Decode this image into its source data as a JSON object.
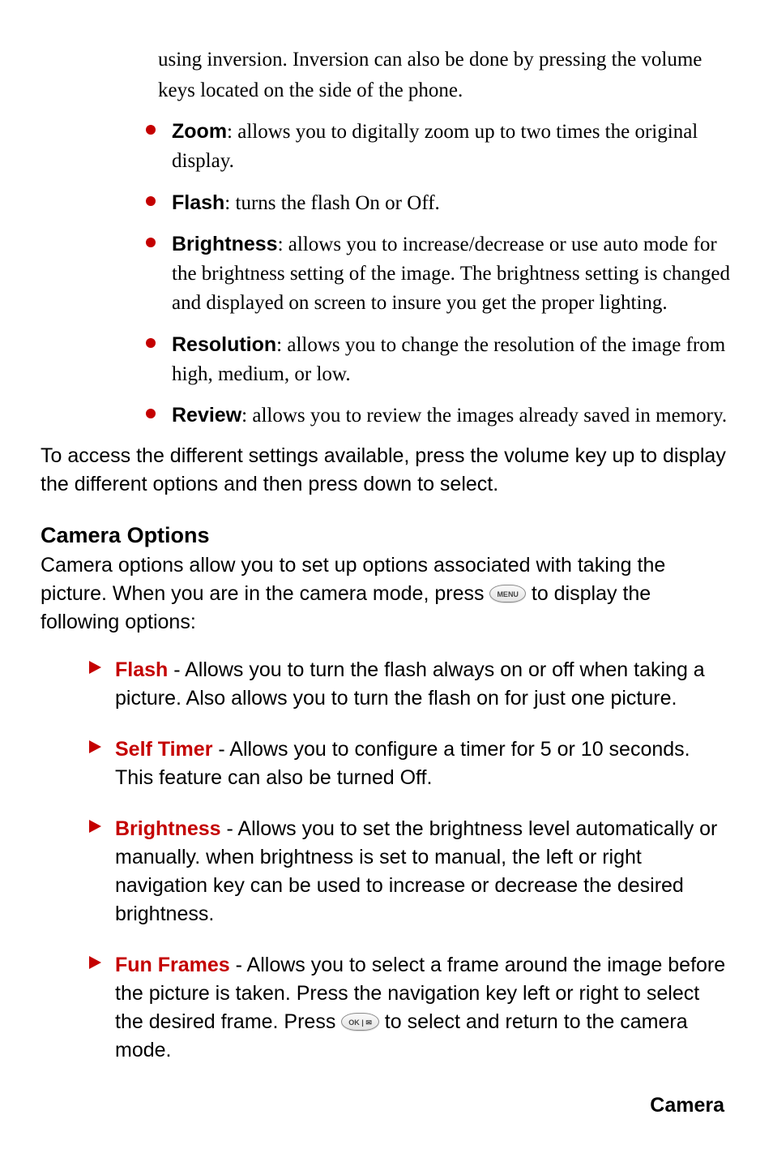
{
  "continuation_text": "using inversion. Inversion can also be done by pressing the volume keys located on the side of the phone.",
  "bullets": [
    {
      "label": "Zoom",
      "text": ": allows you to digitally zoom up to two times the original display."
    },
    {
      "label": "Flash",
      "text": ": turns the flash On or Off."
    },
    {
      "label": "Brightness",
      "text": ": allows you to increase/decrease or use auto mode for the brightness setting of the image. The brightness setting is changed and displayed on screen to insure you get the proper lighting."
    },
    {
      "label": "Resolution",
      "text": ": allows you to change the resolution of the image from high, medium, or low."
    },
    {
      "label": "Review",
      "text": ": allows you to review the images already saved in memory."
    }
  ],
  "access_para": "To access the different settings available, press the volume key up to display the different options and then press down to select.",
  "section_heading": "Camera Options",
  "intro_prefix": "Camera options allow you to set up options associated with taking the picture. When you are in the camera mode, press ",
  "menu_key": "MENU",
  "intro_suffix": " to display the following options:",
  "arrows": [
    {
      "label": "Flash",
      "text": " - Allows you to turn the flash always on or off when taking a picture. Also allows you to turn the flash on for just one picture."
    },
    {
      "label": "Self Timer",
      "text": " - Allows you to configure a timer for 5 or 10 seconds. This feature can also be turned Off."
    },
    {
      "label": "Brightness",
      "text": " - Allows you to set the brightness level automatically or manually. when brightness is set to manual, the left or right navigation key can be used to increase or decrease the desired brightness."
    }
  ],
  "arrow_funframes": {
    "label": "Fun Frames",
    "prefix": " - Allows you to select a frame around the image before the picture is taken. Press the navigation key left or right to select the desired frame. Press ",
    "ok_key": "OK | ✉",
    "suffix": " to select and return to the camera mode."
  },
  "footer": "Camera"
}
